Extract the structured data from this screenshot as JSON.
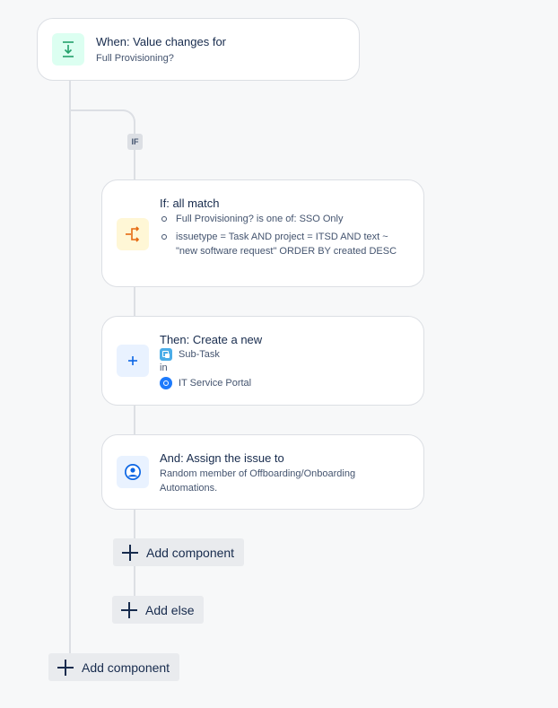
{
  "trigger": {
    "title": "When: Value changes for",
    "subtitle": "Full Provisioning?"
  },
  "if_badge": "IF",
  "condition": {
    "title": "If: all match",
    "items": [
      "Full Provisioning? is one of: SSO Only",
      "issuetype = Task AND project = ITSD AND text ~ \"new software request\" ORDER BY created DESC"
    ]
  },
  "action_create": {
    "title": "Then: Create a new",
    "issue_type": "Sub-Task",
    "in_label": "in",
    "project": "IT Service Portal"
  },
  "action_assign": {
    "title": "And: Assign the issue to",
    "description": "Random member of Offboarding/Onboarding Automations."
  },
  "buttons": {
    "add_component_inner": "Add component",
    "add_else": "Add else",
    "add_component_outer": "Add component"
  },
  "colors": {
    "trigger_icon_bg": "#dcfff1",
    "trigger_icon": "#22a06b",
    "condition_icon_bg": "#fff7d6",
    "condition_icon": "#e56910",
    "action_icon_bg": "#e9f2ff",
    "action_icon": "#0c66e4"
  }
}
